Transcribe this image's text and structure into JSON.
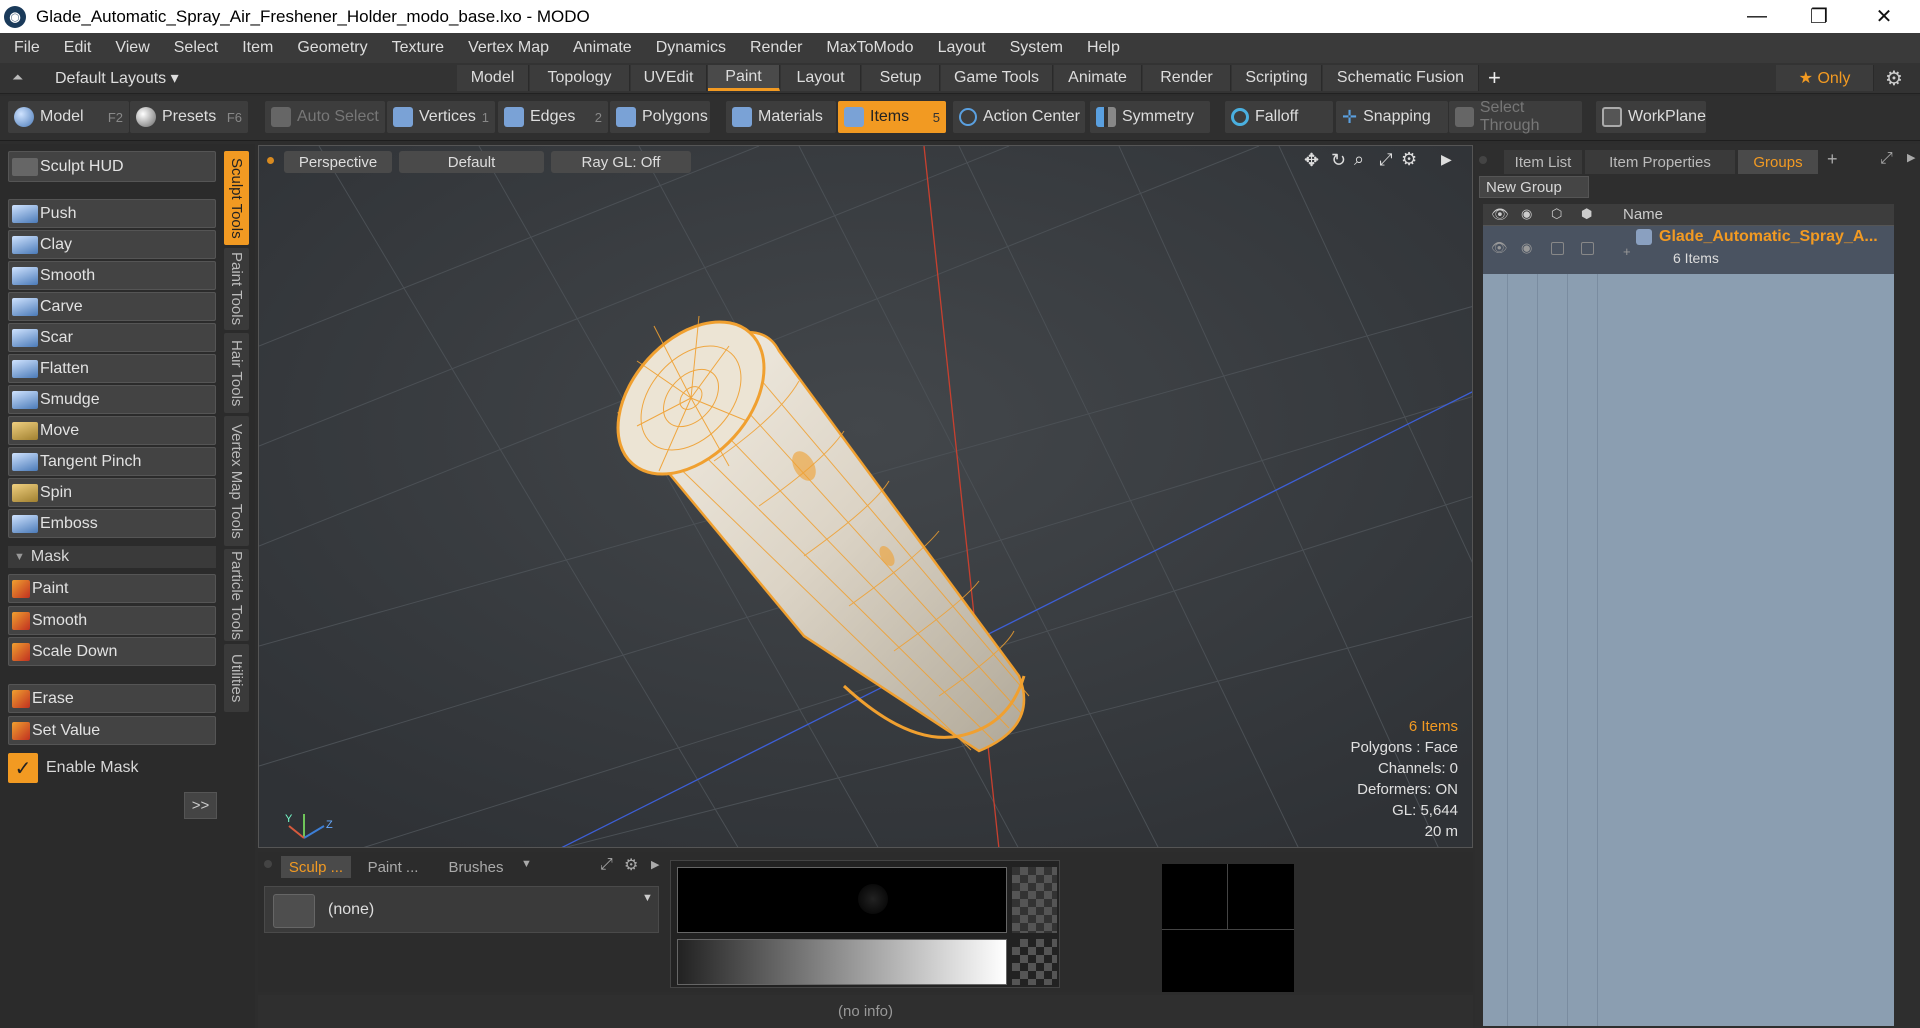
{
  "window": {
    "title": "Glade_Automatic_Spray_Air_Freshener_Holder_modo_base.lxo - MODO",
    "minimize": "—",
    "restore": "❐",
    "close": "✕"
  },
  "menu": [
    "File",
    "Edit",
    "View",
    "Select",
    "Item",
    "Geometry",
    "Texture",
    "Vertex Map",
    "Animate",
    "Dynamics",
    "Render",
    "MaxToModo",
    "Layout",
    "System",
    "Help"
  ],
  "layoutbar": {
    "layouts": "Default Layouts ▾",
    "tabs": [
      "Model",
      "Topology",
      "UVEdit",
      "Paint",
      "Layout",
      "Setup",
      "Game Tools",
      "Animate",
      "Render",
      "Scripting",
      "Schematic Fusion"
    ],
    "active_tab": "Paint",
    "add": "+",
    "only": "★  Only",
    "gear": "⚙"
  },
  "toolbar": {
    "model": "Model",
    "model_key": "F2",
    "presets": "Presets",
    "presets_key": "F6",
    "auto_select": "Auto Select",
    "vertices": "Vertices",
    "vertices_key": "1",
    "edges": "Edges",
    "edges_key": "2",
    "polygons": "Polygons",
    "materials": "Materials",
    "items": "Items",
    "items_key": "5",
    "action_center": "Action Center",
    "symmetry": "Symmetry",
    "falloff": "Falloff",
    "snapping": "Snapping",
    "select_through": "Select Through",
    "workplane": "WorkPlane"
  },
  "sculpt": {
    "hud": "Sculpt HUD",
    "tools": [
      "Push",
      "Clay",
      "Smooth",
      "Carve",
      "Scar",
      "Flatten",
      "Smudge",
      "Move",
      "Tangent Pinch",
      "Spin",
      "Emboss"
    ],
    "mask_header": "Mask",
    "mask_tools": [
      "Paint",
      "Smooth",
      "Scale Down"
    ],
    "other_tools": [
      "Erase",
      "Set Value"
    ],
    "enable_mask": "Enable Mask",
    "more": ">>",
    "vtabs": [
      "Sculpt Tools",
      "Paint Tools",
      "Hair Tools",
      "Vertex Map Tools",
      "Particle Tools",
      "Utilities"
    ]
  },
  "viewport": {
    "view": "Perspective",
    "style": "Default",
    "raygl": "Ray GL: Off",
    "info": {
      "items": "6 Items",
      "polygons": "Polygons : Face",
      "channels": "Channels: 0",
      "deformers": "Deformers: ON",
      "gl": "GL: 5,644",
      "scale": "20 m"
    }
  },
  "right": {
    "tabs": [
      "Item List",
      "Item Properties",
      "Groups"
    ],
    "active_tab": "Groups",
    "add": "+",
    "new_group": "New Group",
    "name_header": "Name",
    "group_name": "Glade_Automatic_Spray_A...",
    "group_count": "6 Items"
  },
  "bottom": {
    "tabs": [
      "Sculp ...",
      "Paint ...",
      "Brushes"
    ],
    "brush": "(none)"
  },
  "status": "(no info)",
  "colors": {
    "accent": "#f29a22",
    "mesh": "#f0a030"
  }
}
